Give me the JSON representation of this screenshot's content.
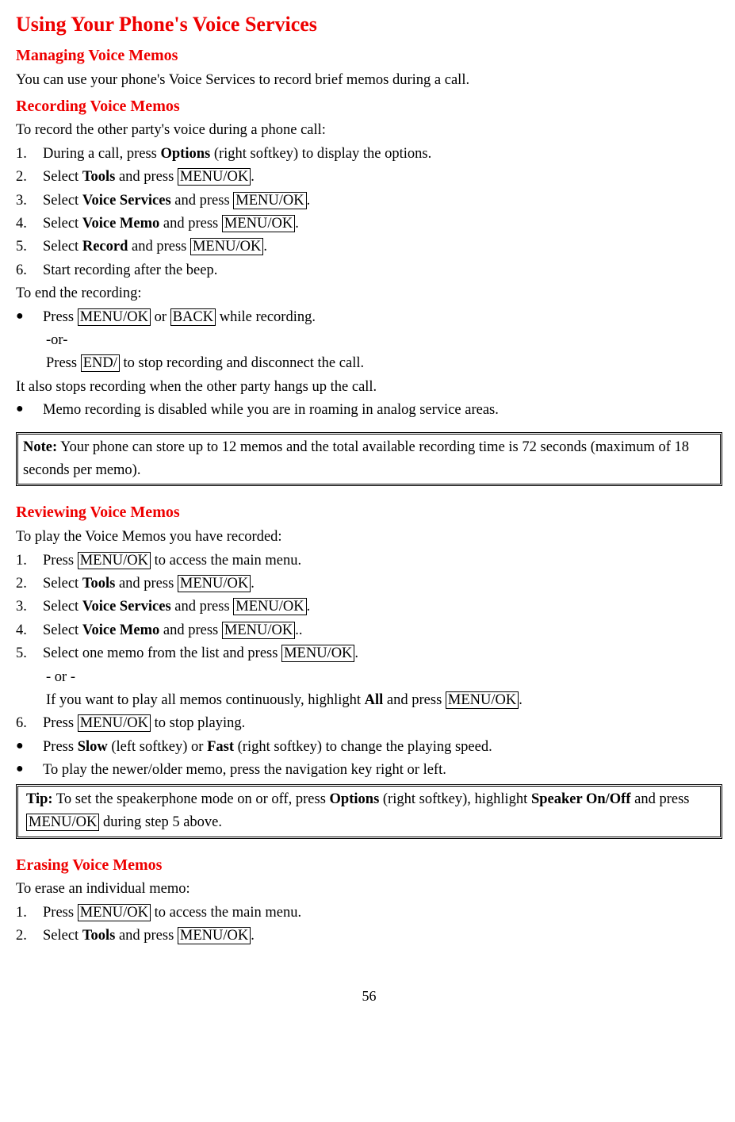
{
  "h1": "Using Your Phone's Voice Services",
  "h2_managing": "Managing Voice Memos",
  "p_intro": "You can use your phone's Voice Services to record brief memos during a call.",
  "h2_recording": "Recording Voice Memos",
  "p_record_intro": "To record the other party's voice during a phone call:",
  "rec": {
    "n1": "1.",
    "t1a": "During a call, press ",
    "t1b": "Options",
    "t1c": " (right softkey) to display the options.",
    "n2": "2.",
    "t2a": "Select ",
    "t2b": "Tools",
    "t2c": " and press ",
    "t2d": "MENU/OK",
    "t2e": ".",
    "n3": "3.",
    "t3a": "Select ",
    "t3b": "Voice Services",
    "t3c": " and press ",
    "t3d": "MENU/OK",
    "t3e": ".",
    "n4": "4.",
    "t4a": "Select ",
    "t4b": "Voice Memo",
    "t4c": " and press ",
    "t4d": "MENU/OK",
    "t4e": ".",
    "n5": "5.",
    "t5a": "Select ",
    "t5b": "Record",
    "t5c": " and press ",
    "t5d": "MENU/OK",
    "t5e": ".",
    "n6": "6.",
    "t6": "Start recording after the beep."
  },
  "p_end": "To end the recording:",
  "end": {
    "b1a": "Press ",
    "b1b": "MENU/OK",
    "b1c": " or ",
    "b1d": "BACK",
    "b1e": " while recording.",
    "or": "-or-",
    "b2a": "Press ",
    "b2b": "END/",
    "b2c": " to stop recording and disconnect the call."
  },
  "p_also": "It also stops recording when the other party hangs up the call.",
  "b_roaming": " Memo recording is disabled while you are in roaming in analog service areas.",
  "note": {
    "label": "Note:",
    "text": " Your phone can store up to 12 memos and the total available recording time is 72 seconds (maximum of 18 seconds per memo)."
  },
  "h2_review": "Reviewing Voice Memos",
  "p_review_intro": "To play the Voice Memos you have recorded:",
  "rev": {
    "n1": "1.",
    "t1a": "Press ",
    "t1b": "MENU/OK",
    "t1c": " to access the main menu.",
    "n2": "2.",
    "t2a": "Select ",
    "t2b": "Tools",
    "t2c": " and press ",
    "t2d": "MENU/OK",
    "t2e": ".",
    "n3": "3.",
    "t3a": "Select ",
    "t3b": "Voice Services",
    "t3c": " and press ",
    "t3d": "MENU/OK",
    "t3e": ".",
    "n4": "4.",
    "t4a": "Select ",
    "t4b": "Voice Memo",
    "t4c": " and press ",
    "t4d": "MENU/OK",
    "t4e": "..",
    "n5": "5.",
    "t5a": "Select one memo from the list and press ",
    "t5b": "MENU/OK",
    "t5c": ".",
    "or": "- or -",
    "t5d": "If you want to play all memos continuously, highlight ",
    "t5e": "All",
    "t5f": " and press ",
    "t5g": "MENU/OK",
    "t5h": ".",
    "n6": "6.",
    "t6a": "Press ",
    "t6b": "MENU/OK",
    "t6c": " to stop playing."
  },
  "rev_b1": {
    "a": "Press ",
    "b": "Slow",
    "c": " (left softkey) or ",
    "d": "Fast",
    "e": " (right softkey) to change the playing speed."
  },
  "rev_b2": "To play the newer/older memo, press the navigation key right or left.",
  "tip": {
    "label": "Tip:",
    "a": " To set the speakerphone mode on or off, press ",
    "b": "Options",
    "c": " (right softkey), highlight ",
    "d": "Speaker On/Off",
    "e": " and press ",
    "f": "MENU/OK",
    "g": " during step 5 above."
  },
  "h2_erase": "Erasing Voice Memos",
  "p_erase_intro": "To erase an individual memo:",
  "era": {
    "n1": "1.",
    "t1a": "Press ",
    "t1b": "MENU/OK",
    "t1c": " to access the main menu.",
    "n2": "2.",
    "t2a": "Select ",
    "t2b": "Tools",
    "t2c": " and press ",
    "t2d": "MENU/OK",
    "t2e": "."
  },
  "bullet_char": "●",
  "pagenum": "56"
}
